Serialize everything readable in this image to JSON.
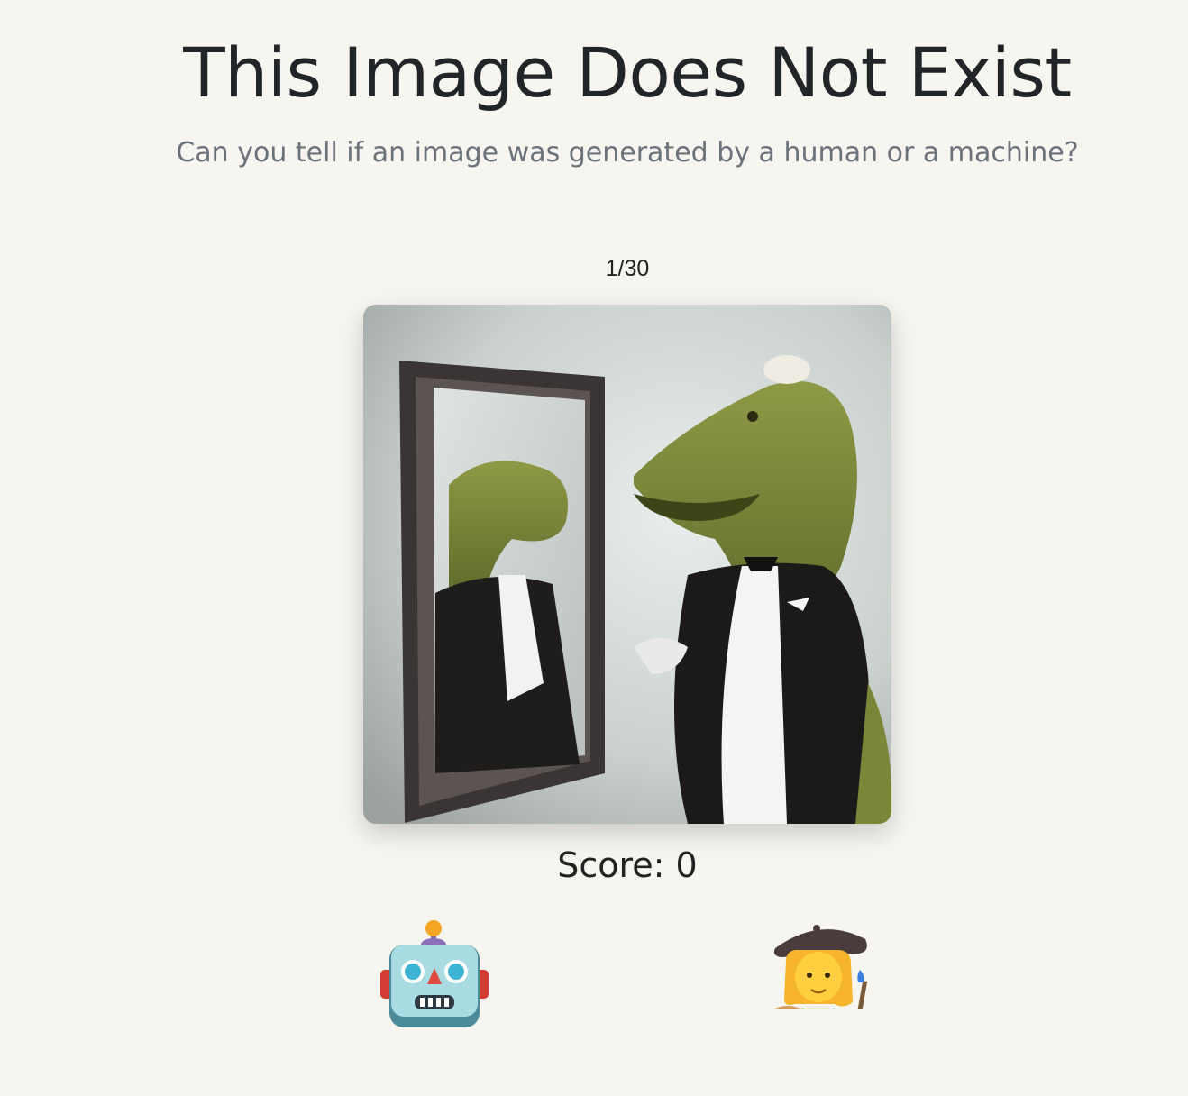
{
  "header": {
    "title": "This Image Does Not Exist",
    "subtitle": "Can you tell if an image was generated by a human or a machine?"
  },
  "game": {
    "progress": "1/30",
    "current_index": 1,
    "total": 30,
    "score_label": "Score: 0",
    "score": 0,
    "image_subject": "dinosaur in tuxedo looking in mirror"
  },
  "choices": [
    {
      "id": "machine",
      "icon": "robot-icon"
    },
    {
      "id": "human",
      "icon": "artist-icon"
    }
  ],
  "colors": {
    "background": "#f6f5ef",
    "title": "#222528",
    "subtitle": "#6b727a"
  }
}
